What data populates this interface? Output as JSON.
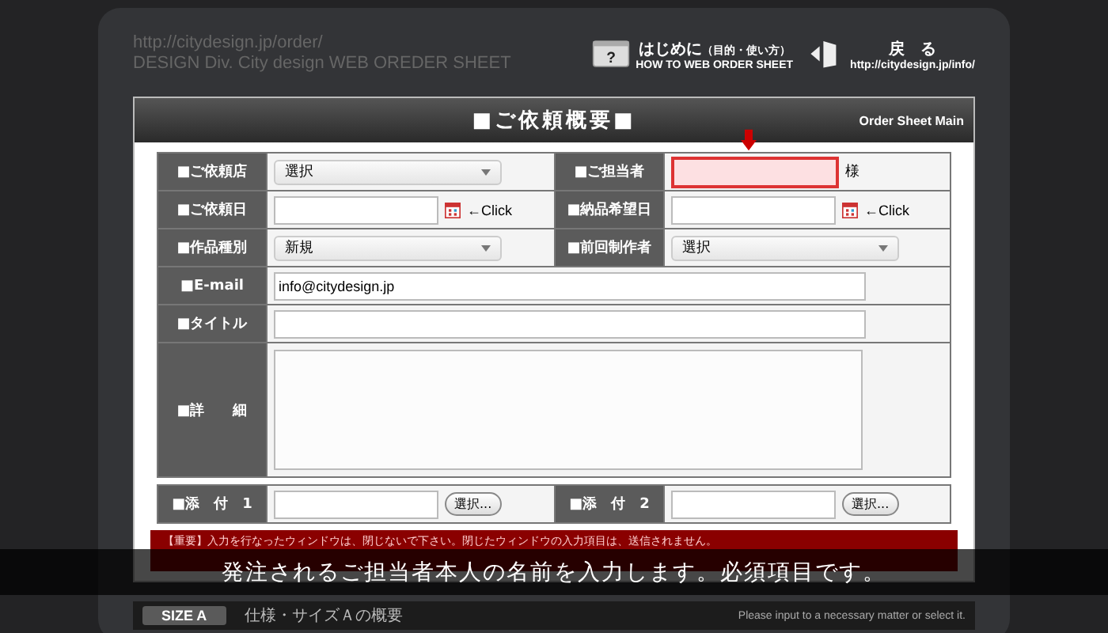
{
  "header": {
    "url": "http://citydesign.jp/order/",
    "subtitle": "DESIGN Div. City design WEB OREDER SHEET",
    "links": [
      {
        "kind": "help",
        "icon": "?",
        "title": "はじめに",
        "note": "（目的・使い方）",
        "caption": "HOW TO WEB ORDER SHEET"
      },
      {
        "kind": "back",
        "title": "戻　る",
        "caption": "http://citydesign.jp/info/"
      }
    ]
  },
  "form": {
    "title": "■ご依頼概要■",
    "tag": "Order Sheet Main",
    "rows": [
      {
        "fields": [
          {
            "label": "■ご依頼店",
            "kind": "select",
            "value": "選択",
            "highlighted": false
          },
          {
            "label": "■ご担当者",
            "kind": "text",
            "suffix": "様",
            "highlighted": true
          }
        ]
      },
      {
        "fields": [
          {
            "label": "■ご依頼日",
            "kind": "date",
            "suffix": "←Click",
            "highlighted": false
          },
          {
            "label": "■納品希望日",
            "kind": "date",
            "suffix": "←Click",
            "highlighted": false
          }
        ]
      },
      {
        "fields": [
          {
            "label": "■作品種別",
            "kind": "select",
            "value": "新規",
            "highlighted": false
          },
          {
            "label": "■前回制作者",
            "kind": "select",
            "value": "選択",
            "highlighted": false
          }
        ]
      },
      {
        "fields": [
          {
            "label": "■E-mail",
            "kind": "text",
            "value": "info@citydesign.jp",
            "highlighted": false
          }
        ]
      },
      {
        "fields": [
          {
            "label": "■タイトル",
            "kind": "text",
            "highlighted": false
          }
        ]
      },
      {
        "fields": [
          {
            "label": "■詳　　細",
            "kind": "textarea",
            "highlighted": false
          }
        ]
      },
      {
        "fields": [
          {
            "label": "■添　付　1",
            "kind": "file",
            "button": "選択...",
            "highlighted": false
          },
          {
            "label": "■添　付　2",
            "kind": "file",
            "button": "選択...",
            "highlighted": false
          }
        ]
      }
    ],
    "notice": "【重要】入力を行なったウィンドウは、閉じないで下さい。閉じたウィンドウの入力項目は、送信されません。"
  },
  "section": {
    "badge": "SIZE A",
    "title": "仕様・サイズＡの概要",
    "hint": "Please input to a necessary matter or select it."
  },
  "caption": "発注されるご担当者本人の名前を入力します。必須項目です。"
}
